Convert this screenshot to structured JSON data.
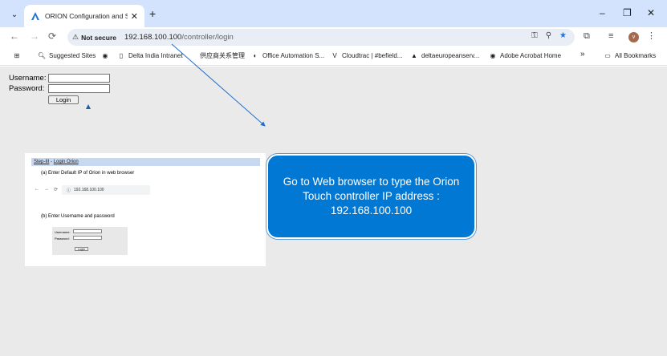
{
  "browser": {
    "tab_title": "ORION Configuration and Supe",
    "tab_close": "✕",
    "new_tab": "+",
    "window": {
      "minimize": "–",
      "maximize": "❐",
      "close": "✕"
    },
    "not_secure_label": "Not secure",
    "url_host": "192.168.100.100",
    "url_path": "/controller/login",
    "avatar_letter": "v"
  },
  "bookmarks": {
    "suggested_sites": "Suggested Sites",
    "delta_intranet": "Delta India Intranet",
    "chinese": "供应商关系管理",
    "office_automation": "Office Automation S...",
    "cloudtrac": "Cloudtrac | #befield...",
    "deltaeurope": "deltaeuropeanserv...",
    "acrobat": "Adobe Acrobat Home",
    "more": "»",
    "all_bookmarks": "All Bookmarks"
  },
  "login_form": {
    "username_label": "Username:",
    "password_label": "Password:",
    "login_button": "Login"
  },
  "instruction_panel": {
    "step_heading": "Step-III",
    "step_title": "Login Orion",
    "item_a": "(a)  Enter Default IP of Orion in web browser",
    "mini_url": "192.168.100.100",
    "item_b": "(b)  Enter Username and password",
    "mini_username": "Username:",
    "mini_password": "Password:",
    "mini_login": "Login"
  },
  "callout": {
    "text": "Go to Web browser to type the Orion Touch controller IP address : 192.168.100.100",
    "color": "#0078d4"
  },
  "colors": {
    "tab_strip": "#d3e3fd",
    "content_bg": "#eaeaea",
    "star": "#1a73e8"
  }
}
